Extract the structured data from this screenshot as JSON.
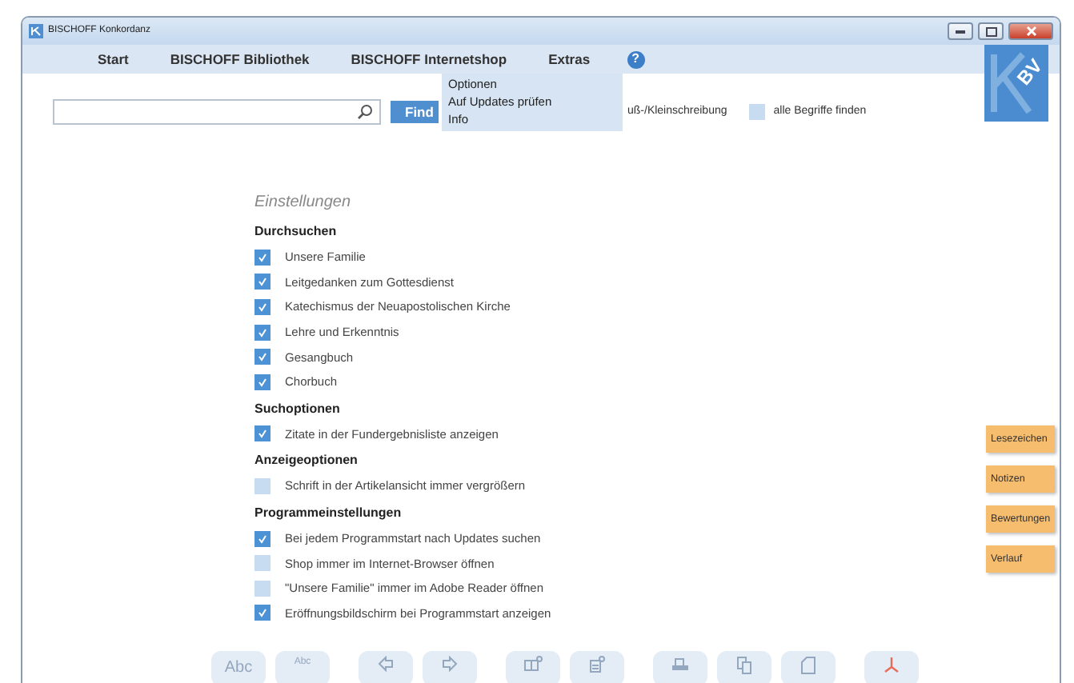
{
  "window": {
    "title": "BISCHOFF Konkordanz"
  },
  "menu": [
    {
      "label": "Start"
    },
    {
      "label": "**BISCHOFF** Bibliothek"
    },
    {
      "label": "**BISCHOFF** Internetshop"
    },
    {
      "label": "Extras"
    }
  ],
  "help": "?",
  "logo": "BV",
  "extras_menu": [
    "Optionen",
    "Auf Updates prüfen",
    "Info"
  ],
  "search": {
    "find_button": "Find",
    "case_option": "uß-/Kleinschreibung",
    "all_terms": {
      "label": "alle Begriffe finden",
      "checked": false
    }
  },
  "settings": {
    "title": "Einstellungen",
    "sections": [
      {
        "heading": "Durchsuchen",
        "items": [
          {
            "label": "Unsere Familie",
            "checked": true
          },
          {
            "label": "Leitgedanken zum Gottesdienst",
            "checked": true
          },
          {
            "label": "Katechismus der Neuapostolischen Kirche",
            "checked": true
          },
          {
            "label": "Lehre und Erkenntnis",
            "checked": true
          },
          {
            "label": "Gesangbuch",
            "checked": true
          },
          {
            "label": "Chorbuch",
            "checked": true
          }
        ]
      },
      {
        "heading": "Suchoptionen",
        "items": [
          {
            "label": "Zitate in der Fundergebnisliste anzeigen",
            "checked": true
          }
        ]
      },
      {
        "heading": "Anzeigeoptionen",
        "items": [
          {
            "label": "Schrift in der Artikelansicht immer vergrößern",
            "checked": false
          }
        ]
      },
      {
        "heading": "Programmeinstellungen",
        "items": [
          {
            "label": "Bei jedem Programmstart nach Updates suchen",
            "checked": true
          },
          {
            "label": "Shop immer im Internet-Browser öffnen",
            "checked": false
          },
          {
            "label": "\"Unsere Familie\" immer im Adobe Reader öffnen",
            "checked": false
          },
          {
            "label": "Eröffnungsbildschirm bei Programmstart anzeigen",
            "checked": true
          }
        ]
      }
    ]
  },
  "side_tabs": [
    "Lesezeichen",
    "Notizen",
    "Bewertungen",
    "Verlauf"
  ],
  "toolbar": [
    {
      "kind": "text-large",
      "label": "Abc"
    },
    {
      "kind": "text-small",
      "label": "Abc"
    },
    {
      "kind": "back"
    },
    {
      "kind": "forward"
    },
    {
      "kind": "book-add"
    },
    {
      "kind": "note-add"
    },
    {
      "kind": "print"
    },
    {
      "kind": "copy"
    },
    {
      "kind": "document"
    },
    {
      "kind": "pdf"
    }
  ]
}
